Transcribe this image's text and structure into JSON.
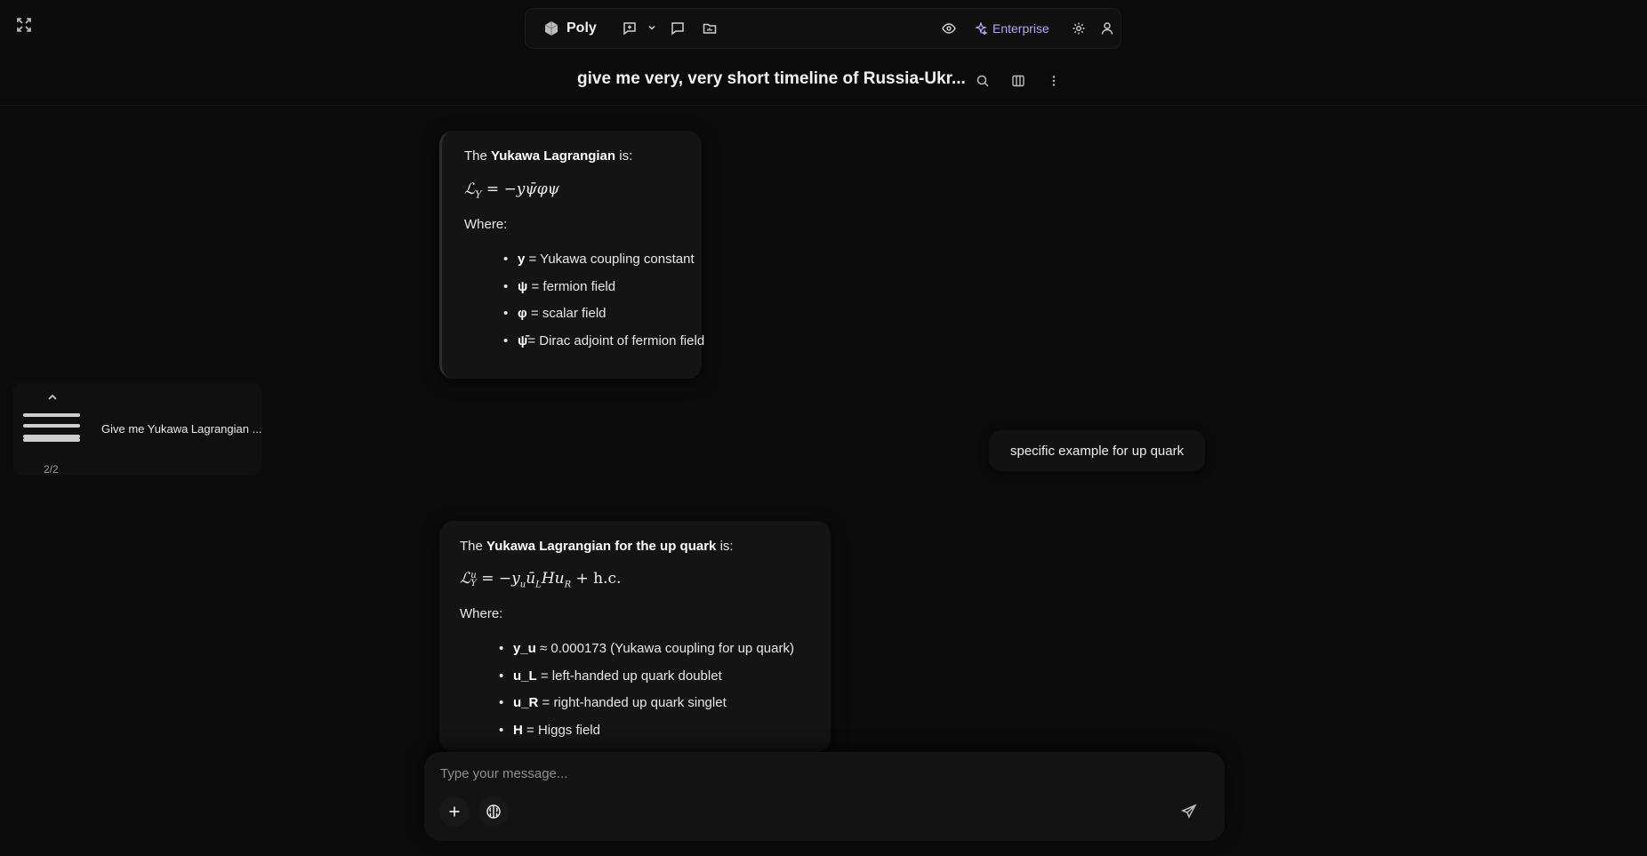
{
  "topbar": {
    "brand_name": "Poly",
    "enterprise_label": "Enterprise",
    "icons": [
      "expand-icon",
      "logo-icon",
      "new-chat-icon",
      "chevron-down-icon",
      "chat-icon",
      "folder-icon",
      "eye-icon",
      "sparkle-icon",
      "gear-icon",
      "user-icon"
    ]
  },
  "header": {
    "title": "give me very, very short timeline of Russia-Ukr...",
    "icons": [
      "search-icon",
      "columns-icon",
      "more-vertical-icon"
    ]
  },
  "thread_nav": {
    "label": "Give me Yukawa Lagrangian ...",
    "count": "2/2"
  },
  "messages": [
    {
      "role": "assistant",
      "intro_prefix": "The ",
      "intro_bold": "Yukawa Lagrangian",
      "intro_suffix": " is:",
      "equation": "ℒ",
      "equation_sub": "Y",
      "equation_rhs": " = −yψ̄φψ",
      "where": "Where:",
      "items": [
        {
          "term": "y",
          "desc": " = Yukawa coupling constant"
        },
        {
          "term": "ψ",
          "desc": " = fermion field"
        },
        {
          "term": "φ",
          "desc": " = scalar field"
        },
        {
          "term": "ψ̄",
          "desc": "= Dirac adjoint of fermion field"
        }
      ]
    },
    {
      "role": "user",
      "text": "specific example for up quark"
    },
    {
      "role": "assistant",
      "intro_prefix": "The ",
      "intro_bold": "Yukawa Lagrangian for the up quark",
      "intro_suffix": " is:",
      "equation": "ℒ",
      "equation_sup": "u",
      "equation_sub": "Y",
      "equation_rhs": " = −y",
      "equation_rhs_sub": "u",
      "equation_rhs2": "ū",
      "equation_rhs2_sub": "L",
      "equation_rhs3": "Hu",
      "equation_rhs3_sub": "R",
      "equation_tail": " + h.c.",
      "where": "Where:",
      "items": [
        {
          "term": "y_u",
          "desc": " ≈ 0.000173 (Yukawa coupling for up quark)"
        },
        {
          "term": "u_L",
          "desc": " = left-handed up quark doublet"
        },
        {
          "term": "u_R",
          "desc": " = right-handed up quark singlet"
        },
        {
          "term": "H",
          "desc": " = Higgs field"
        }
      ]
    }
  ],
  "composer": {
    "placeholder": "Type your message...",
    "icons": [
      "plus-icon",
      "brain-icon",
      "send-icon"
    ]
  }
}
